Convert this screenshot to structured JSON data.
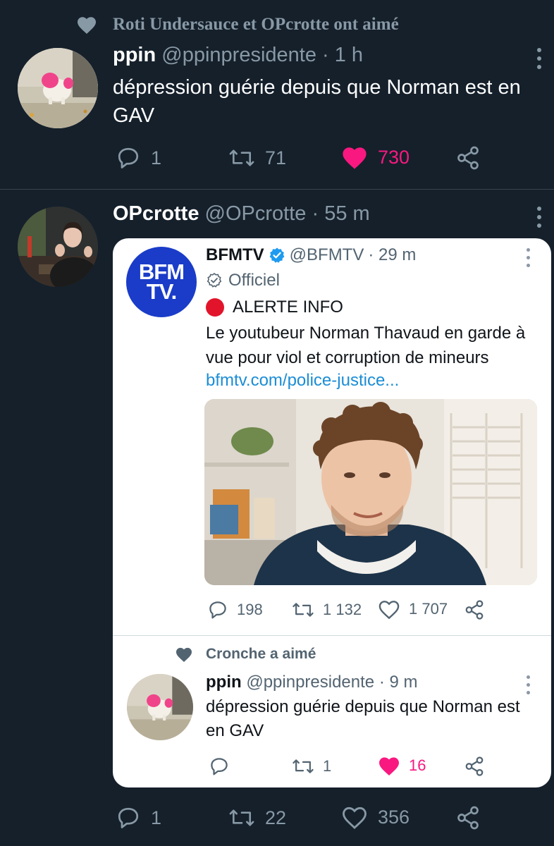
{
  "tweet1": {
    "social_context": "Roti Undersauce et OPcrotte ont aimé",
    "author_name": "ppin",
    "author_handle": "@ppinpresidente",
    "time": "· 1 h",
    "text": "dépression guérie depuis que Norman est en GAV",
    "replies": "1",
    "retweets": "71",
    "likes": "730",
    "icons": [
      "heart-icon",
      "more-icon",
      "reply-icon",
      "retweet-icon",
      "share-icon"
    ]
  },
  "tweet2": {
    "author_name": "OPcrotte",
    "author_handle": "@OPcrotte",
    "time": "· 55 m",
    "replies": "1",
    "retweets": "22",
    "likes": "356",
    "quote": {
      "logo_line1": "BFM",
      "logo_line2": "TV.",
      "author_name": "BFMTV",
      "author_handle": "@BFMTV",
      "time": "· 29 m",
      "label": "Officiel",
      "alert": "ALERTE INFO",
      "text": "Le youtubeur Norman Thavaud en garde à vue pour viol et corruption de mineurs",
      "link": "bfmtv.com/police-justice...",
      "replies": "198",
      "retweets": "1 132",
      "likes": "1 707",
      "social_context": "Cronche a aimé",
      "nested": {
        "author_name": "ppin",
        "author_handle": "@ppinpresidente",
        "time": "· 9 m",
        "text": "dépression guérie depuis que Norman est en GAV",
        "retweets": "1",
        "likes": "16"
      }
    }
  },
  "colors": {
    "background": "#15202b",
    "muted": "#8899a6",
    "like_pink": "#f91880",
    "verified_blue": "#1d9bf0",
    "link_blue": "#1b8dd6",
    "alert_red": "#e2142b",
    "bfm_blue": "#1a3cc9"
  }
}
